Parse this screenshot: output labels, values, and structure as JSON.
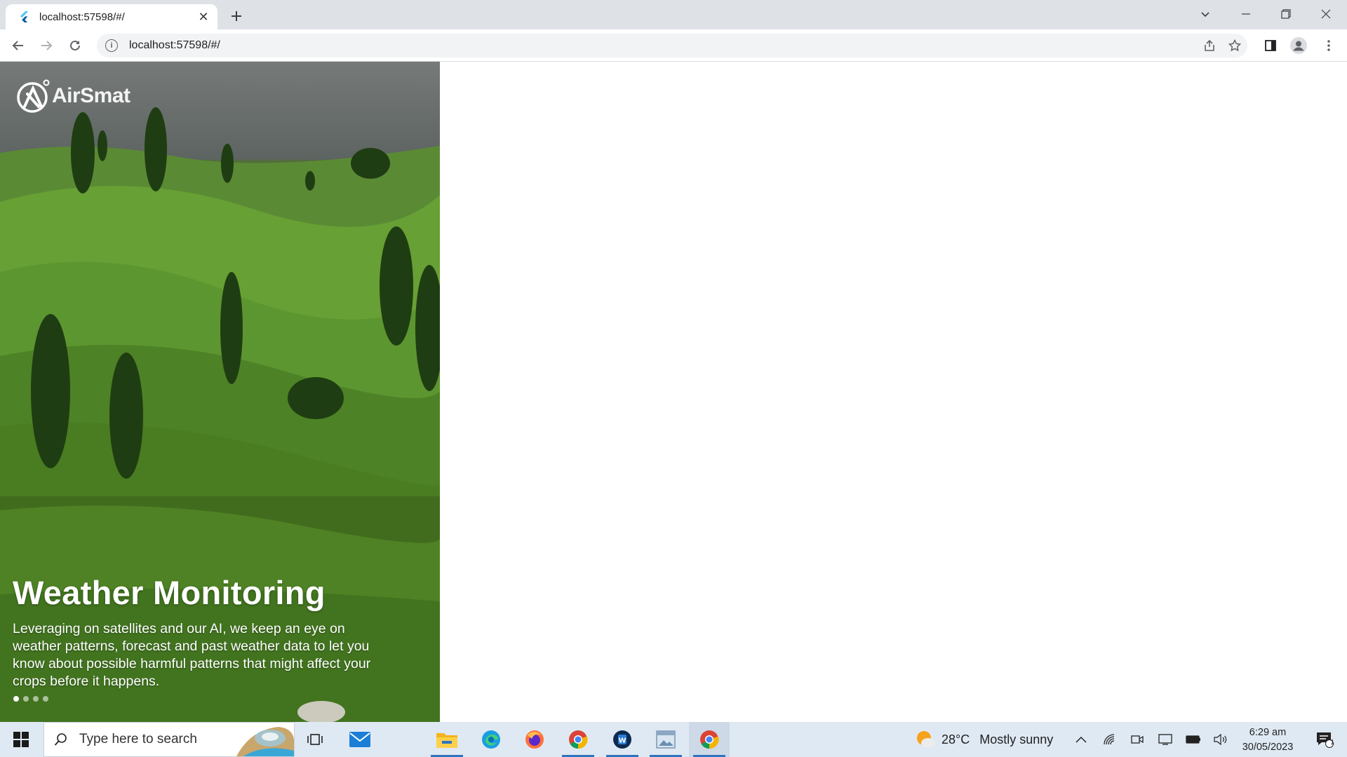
{
  "browser": {
    "tab": {
      "title": "localhost:57598/#/",
      "close_glyph": "✕"
    },
    "new_tab_glyph": "+",
    "url": "localhost:57598/#/"
  },
  "hero": {
    "logo_text": "AirSmat",
    "title": "Weather Monitoring",
    "description": "Leveraging on satellites and our AI, we keep an eye on weather patterns, forecast and past weather data to let you know about possible harmful patterns that might affect your crops before it happens.",
    "slides_total": 4,
    "slide_active": 1
  },
  "taskbar": {
    "search_placeholder": "Type here to search",
    "weather_temp": "28°C",
    "weather_desc": "Mostly sunny",
    "time": "6:29 am",
    "date": "30/05/2023",
    "notification_count": "1"
  }
}
